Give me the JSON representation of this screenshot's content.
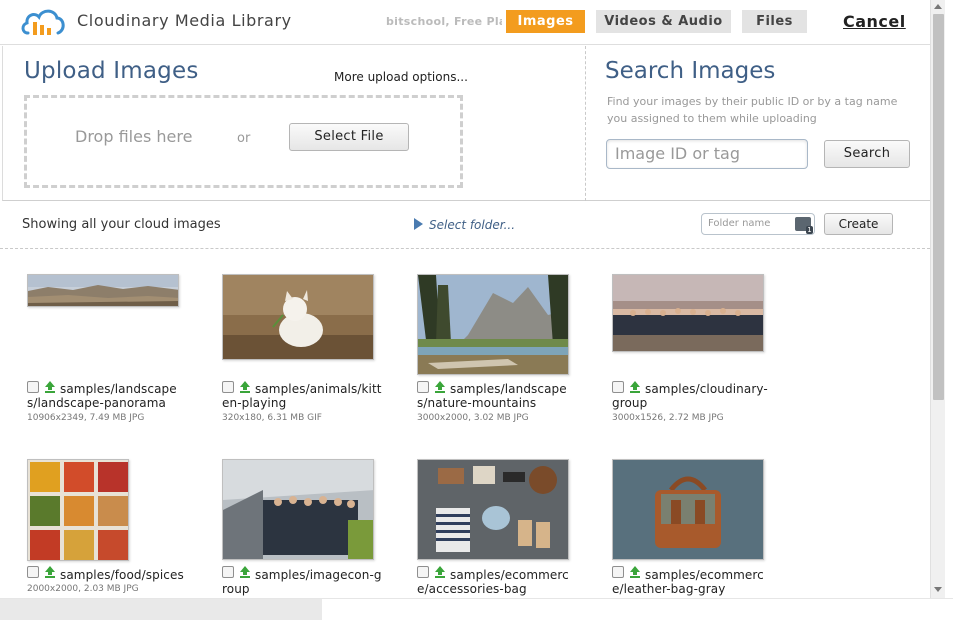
{
  "header": {
    "title": "Cloudinary Media Library",
    "account": "bitschool, Free Plan",
    "tabs": [
      {
        "label": "Images",
        "active": true
      },
      {
        "label": "Videos & Audio",
        "active": false
      },
      {
        "label": "Files",
        "active": false
      }
    ],
    "cancel_label": "Cancel"
  },
  "upload": {
    "title": "Upload Images",
    "more_options": "More upload options...",
    "drop_text": "Drop files here",
    "or_text": "or",
    "select_file_label": "Select File"
  },
  "search": {
    "title": "Search Images",
    "help": "Find your images by their public ID or by a tag name you assigned to them while uploading",
    "placeholder": "Image ID or tag",
    "button_label": "Search"
  },
  "folder_bar": {
    "showing": "Showing all your cloud images",
    "select_folder": "Select folder...",
    "folder_placeholder": "Folder name",
    "create_label": "Create"
  },
  "images": [
    {
      "name": "samples/landscapes/landscape-panorama",
      "meta": "10906x2349, 7.49 MB JPG"
    },
    {
      "name": "samples/animals/kitten-playing",
      "meta": "320x180, 6.31 MB GIF"
    },
    {
      "name": "samples/landscapes/nature-mountains",
      "meta": "3000x2000, 3.02 MB JPG"
    },
    {
      "name": "samples/cloudinary-group",
      "meta": "3000x1526, 2.72 MB JPG"
    },
    {
      "name": "samples/food/spices",
      "meta": "2000x2000, 2.03 MB JPG"
    },
    {
      "name": "samples/imagecon-group",
      "meta": ""
    },
    {
      "name": "samples/ecommerce/accessories-bag",
      "meta": ""
    },
    {
      "name": "samples/ecommerce/leather-bag-gray",
      "meta": ""
    }
  ],
  "colors": {
    "accent": "#f39c1e",
    "title_blue": "#3f5f86",
    "download_green": "#3aa53a"
  }
}
